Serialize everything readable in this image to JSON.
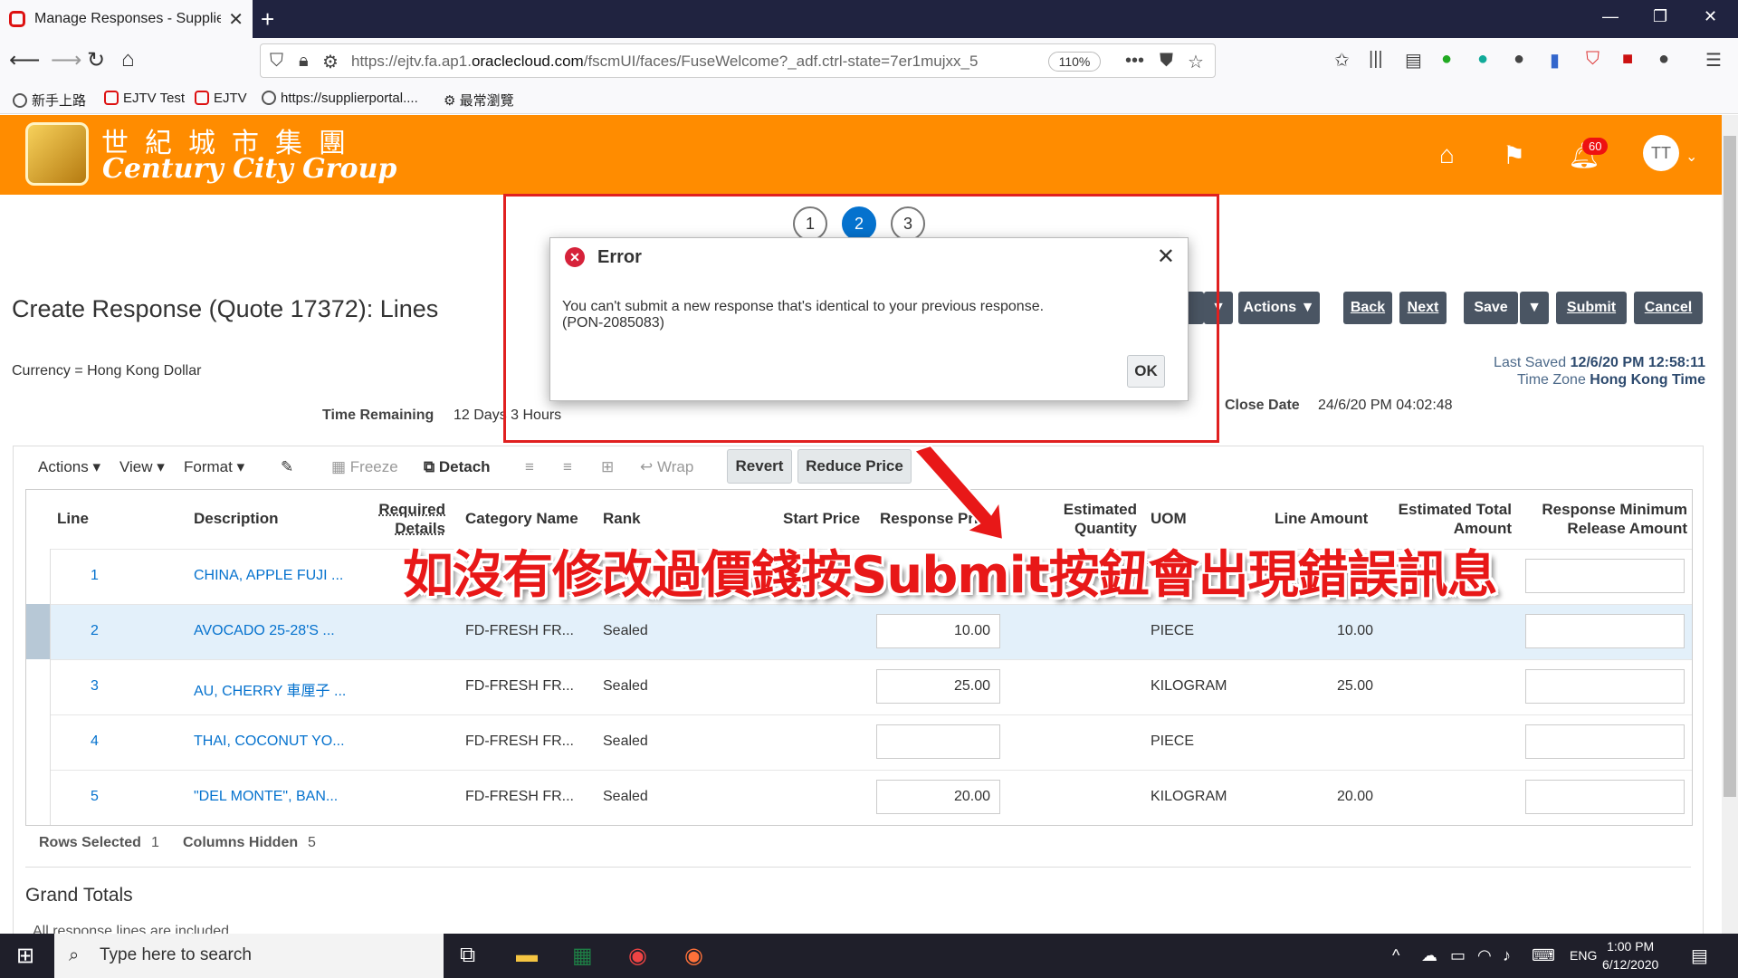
{
  "browser": {
    "tab_title": "Manage Responses - Supplier P",
    "url_prefix": "https://ejtv.fa.ap1.",
    "url_domain": "oraclecloud.com",
    "url_rest": "/fscmUI/faces/FuseWelcome?_adf.ctrl-state=7er1mujxx_5",
    "zoom": "110%",
    "bookmarks": [
      "新手上路",
      "EJTV Test",
      "EJTV",
      "https://supplierportal....",
      "最常瀏覽"
    ]
  },
  "banner": {
    "company_cn": "世紀城市集團",
    "company_en": "Century City Group",
    "notification_count": "60",
    "avatar_initials": "TT"
  },
  "train": [
    "1",
    "2",
    "3"
  ],
  "page": {
    "title": "Create Response (Quote 17372): Lines",
    "currency": "Currency = Hong Kong Dollar",
    "time_remaining_label": "Time Remaining",
    "time_remaining_value": "12 Days 3 Hours",
    "close_date_label": "Close Date",
    "close_date_value": "24/6/20 PM 04:02:48",
    "last_saved_label": "Last Saved",
    "last_saved_value": "12/6/20 PM 12:58:11",
    "timezone_label": "Time Zone",
    "timezone_value": "Hong Kong Time"
  },
  "toolbar": {
    "actions": "Actions",
    "back": "Back",
    "next": "Next",
    "save": "Save",
    "submit": "Submit",
    "cancel": "Cancel"
  },
  "table_toolbar": {
    "actions": "Actions",
    "view": "View",
    "format": "Format",
    "freeze": "Freeze",
    "detach": "Detach",
    "wrap": "Wrap",
    "revert": "Revert",
    "reduce_price": "Reduce Price"
  },
  "columns": {
    "line": "Line",
    "description": "Description",
    "required_details": "Required Details",
    "category": "Category Name",
    "rank": "Rank",
    "start_price": "Start Price",
    "response_price": "Response Price",
    "est_qty": "Estimated Quantity",
    "uom": "UOM",
    "line_amount": "Line Amount",
    "est_total": "Estimated Total Amount",
    "min_release": "Response Minimum Release Amount"
  },
  "rows": [
    {
      "line": "1",
      "description": "CHINA, APPLE FUJI ...",
      "category": "",
      "rank": "",
      "price": "",
      "uom": "",
      "amount": ""
    },
    {
      "line": "2",
      "description": "AVOCADO 25-28'S ...",
      "category": "FD-FRESH FR...",
      "rank": "Sealed",
      "price": "10.00",
      "uom": "PIECE",
      "amount": "10.00"
    },
    {
      "line": "3",
      "description": "AU, CHERRY 車厘子 ...",
      "category": "FD-FRESH FR...",
      "rank": "Sealed",
      "price": "25.00",
      "uom": "KILOGRAM",
      "amount": "25.00"
    },
    {
      "line": "4",
      "description": "THAI, COCONUT YO...",
      "category": "FD-FRESH FR...",
      "rank": "Sealed",
      "price": "",
      "uom": "PIECE",
      "amount": ""
    },
    {
      "line": "5",
      "description": "\"DEL MONTE\", BAN...",
      "category": "FD-FRESH FR...",
      "rank": "Sealed",
      "price": "20.00",
      "uom": "KILOGRAM",
      "amount": "20.00"
    }
  ],
  "footer": {
    "rows_selected_label": "Rows Selected",
    "rows_selected": "1",
    "columns_hidden_label": "Columns Hidden",
    "columns_hidden": "5",
    "grand_totals": "Grand Totals",
    "included_note": "All response lines are included"
  },
  "dialog": {
    "title": "Error",
    "message_line1": "You can't submit a new response that's identical to your previous response.",
    "message_line2": "(PON-2085083)",
    "ok": "OK"
  },
  "annotation": "如沒有修改過價錢按Submit按鈕會出現錯誤訊息",
  "taskbar": {
    "search_placeholder": "Type here to search",
    "lang": "ENG",
    "time": "1:00 PM",
    "date": "6/12/2020"
  },
  "colors": {
    "banner": "#ff8c00",
    "primary_button": "#4a5563",
    "link": "#0572ce",
    "error_red": "#e02020"
  }
}
